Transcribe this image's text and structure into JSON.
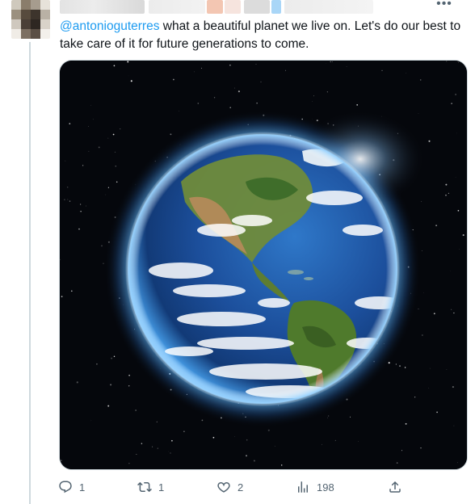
{
  "tweet": {
    "more_label": "•••",
    "mention": "@antonioguterres",
    "body": " what a beautiful planet we live on. Let's do our best to take care of it for future generations to come.",
    "media_icon": "earth-image",
    "actions": {
      "reply": {
        "icon": "reply-icon",
        "count": "1"
      },
      "retweet": {
        "icon": "retweet-icon",
        "count": "1"
      },
      "like": {
        "icon": "like-icon",
        "count": "2"
      },
      "views": {
        "icon": "views-icon",
        "count": "198"
      },
      "share": {
        "icon": "share-icon"
      }
    }
  },
  "colors": {
    "link": "#1d9bf0",
    "text": "#0f1419",
    "muted": "#536471",
    "border": "#cfd9de",
    "space": "#05070c",
    "ocean": "#1c4f9c",
    "glow": "#5fb6ff"
  }
}
